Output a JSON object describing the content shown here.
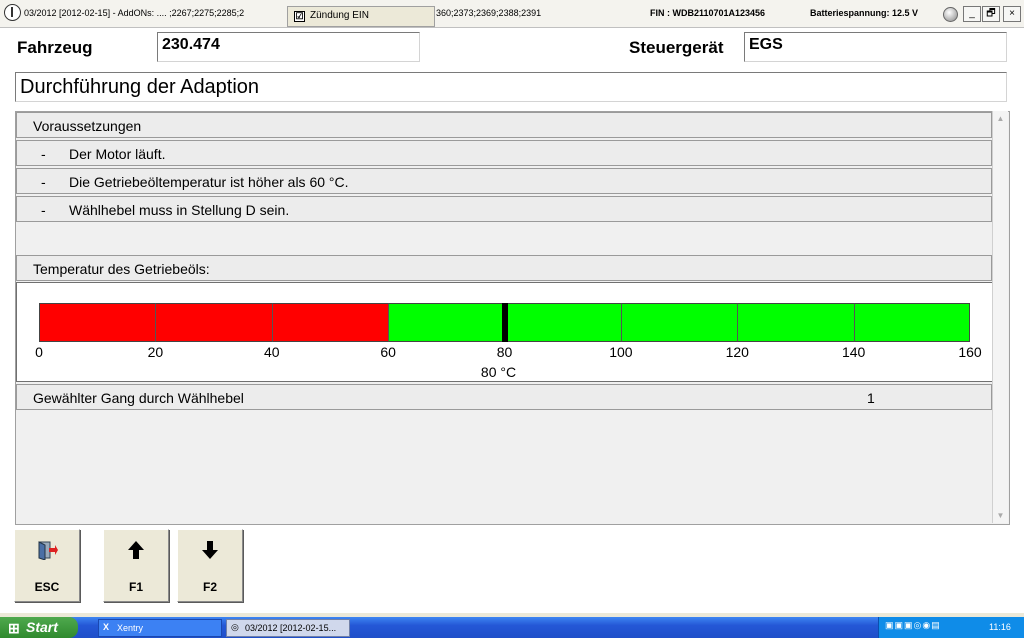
{
  "titlebar": {
    "title": "03/2012 [2012-02-15] - AddONs:  .... ;2267;2275;2285;2",
    "title_continued": "360;2373;2369;2388;2391",
    "ignition_label": "Zündung EIN",
    "ignition_checked": "☑",
    "fin": "FIN : WDB2110701A123456",
    "battery": "Batteriespannung: 12.5 V",
    "minimize": "_",
    "restore": "🗗",
    "close": "×"
  },
  "header": {
    "vehicle_label": "Fahrzeug",
    "vehicle_value": "230.474",
    "ecu_label": "Steuergerät",
    "ecu_value": "EGS",
    "page_title": "Durchführung der Adaption"
  },
  "prerequisites": {
    "heading": "Voraussetzungen",
    "items": [
      {
        "dash": "-",
        "text": "Der Motor läuft."
      },
      {
        "dash": "-",
        "text": "Die Getriebeöltemperatur ist höher als 60 °C."
      },
      {
        "dash": "-",
        "text": "Wählhebel muss in Stellung D sein."
      }
    ]
  },
  "oil_temperature": {
    "label": "Temperatur des Getriebeöls:",
    "scale_min": 0,
    "scale_max": 160,
    "red_until": 60,
    "value": 80,
    "value_text": "80 °C",
    "ticks": [
      "0",
      "20",
      "40",
      "60",
      "80",
      "100",
      "120",
      "140",
      "160"
    ],
    "colors": {
      "red": "#ff0000",
      "green": "#00ff00",
      "marker": "#000000"
    }
  },
  "gear": {
    "label": "Gewählter Gang durch Wählhebel",
    "value": "1"
  },
  "function_keys": [
    {
      "icon": "door-exit-icon",
      "label": "ESC"
    },
    {
      "icon": "arrow-up-icon",
      "label": "F1"
    },
    {
      "icon": "arrow-down-icon",
      "label": "F2"
    }
  ],
  "taskbar": {
    "start": "Start",
    "tasks": [
      "Xentry",
      "03/2012 [2012-02-15..."
    ],
    "clock": "11:16"
  }
}
